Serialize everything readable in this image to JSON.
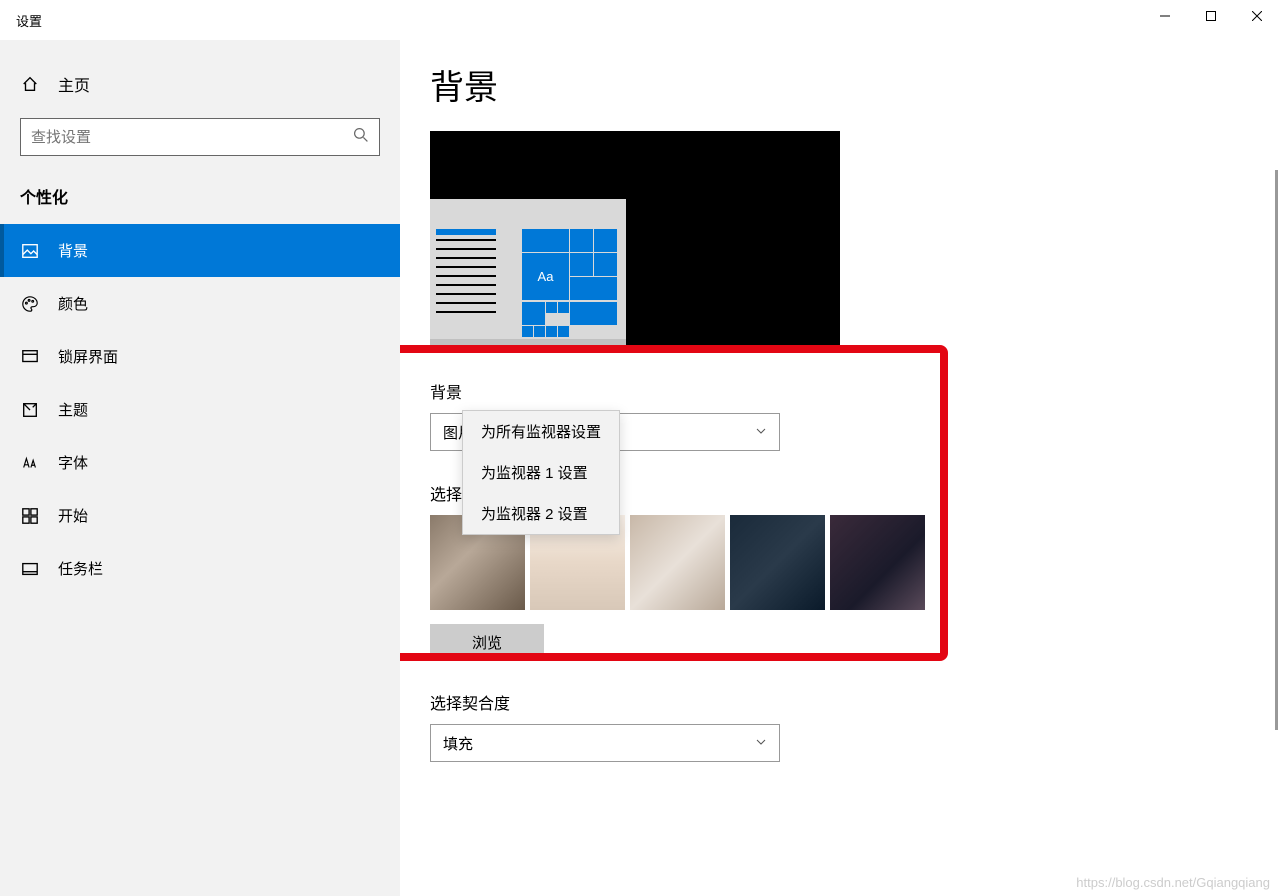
{
  "titlebar": {
    "title": "设置"
  },
  "sidebar": {
    "home": "主页",
    "search_placeholder": "查找设置",
    "section": "个性化",
    "items": [
      {
        "label": "背景"
      },
      {
        "label": "颜色"
      },
      {
        "label": "锁屏界面"
      },
      {
        "label": "主题"
      },
      {
        "label": "字体"
      },
      {
        "label": "开始"
      },
      {
        "label": "任务栏"
      }
    ]
  },
  "main": {
    "title": "背景",
    "preview_tile_text": "Aa",
    "bg_label": "背景",
    "bg_value": "图片",
    "choose_label": "选择图片",
    "browse": "浏览",
    "fit_label": "选择契合度",
    "fit_value": "填充"
  },
  "context_menu": {
    "items": [
      "为所有监视器设置",
      "为监视器 1 设置",
      "为监视器 2 设置"
    ]
  },
  "watermark": "https://blog.csdn.net/Gqiangqiang"
}
